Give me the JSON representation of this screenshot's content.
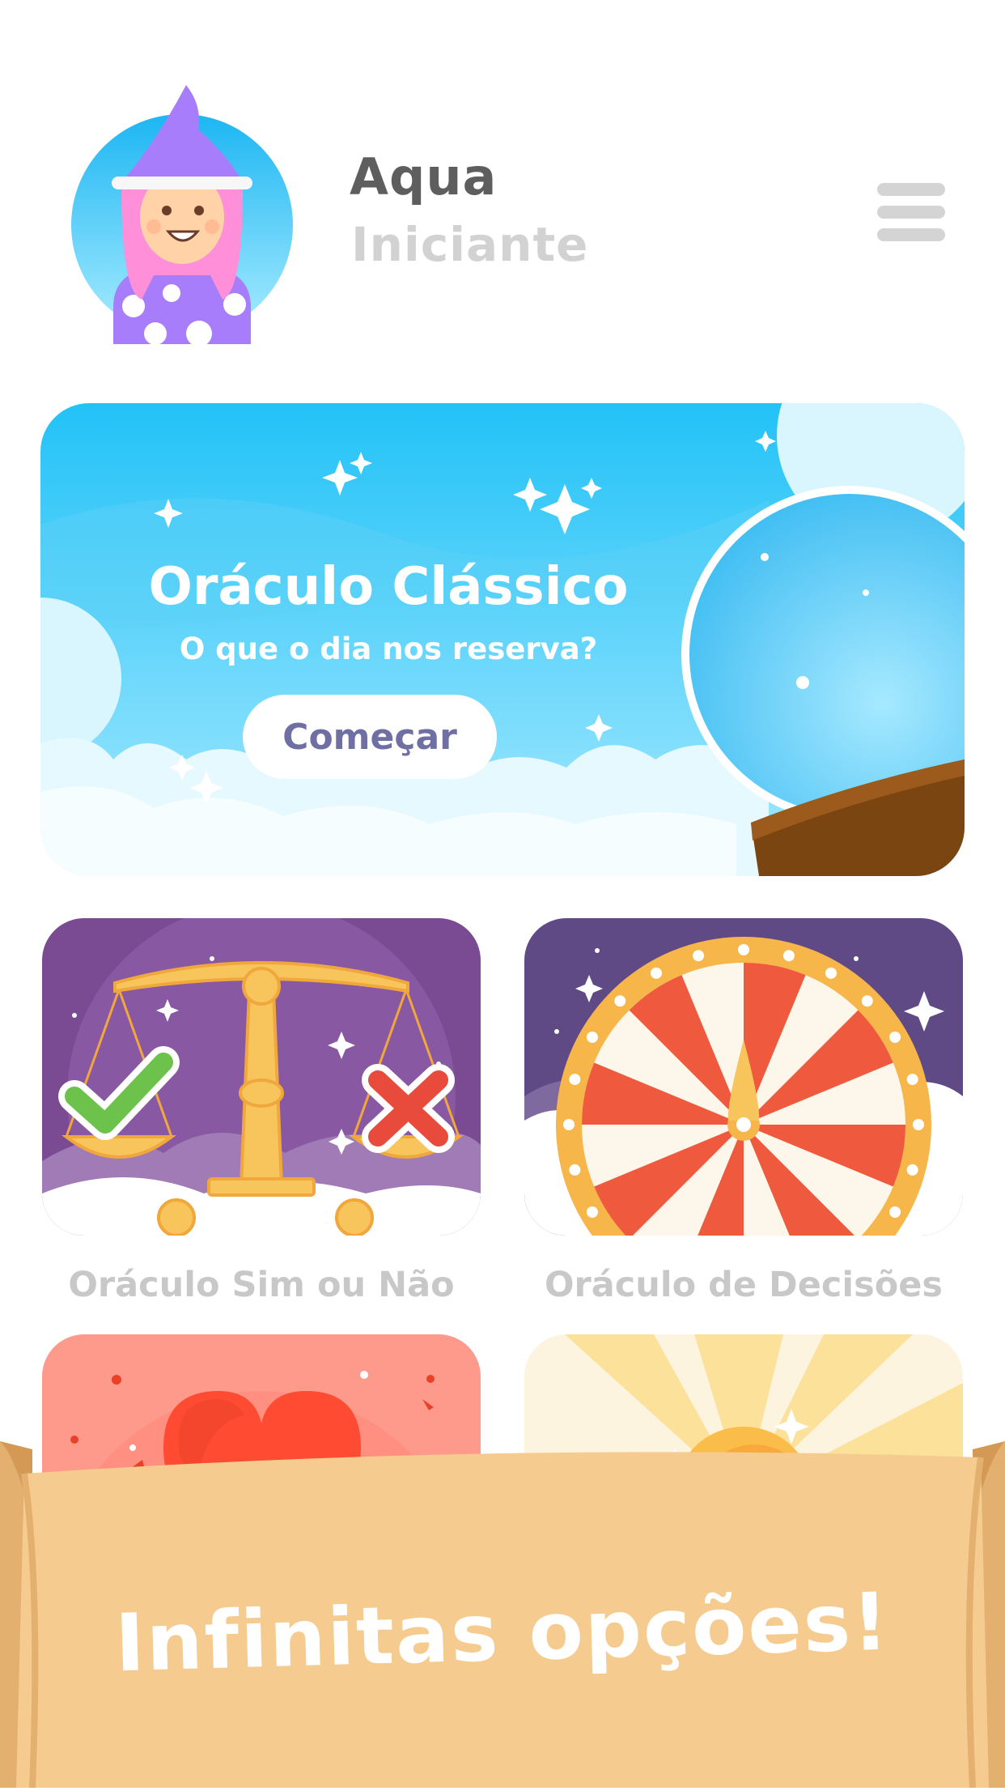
{
  "profile": {
    "name": "Aqua",
    "level": "Iniciante"
  },
  "menu": {
    "icon": "hamburger-menu-icon"
  },
  "hero": {
    "title": "Oráculo Clássico",
    "subtitle": "O que o dia nos reserva?",
    "button_label": "Começar",
    "colors": {
      "sky": "#3fc4f5",
      "cloud": "#d9f6ff",
      "button_text": "#6f6fa4"
    }
  },
  "oracles": [
    {
      "label": "Oráculo Sim ou Não",
      "icon": "scales-icon"
    },
    {
      "label": "Oráculo de Decisões",
      "icon": "wheel-icon"
    },
    {
      "label": "",
      "icon": "heart-icon"
    },
    {
      "label": "",
      "icon": "sun-icon"
    }
  ],
  "banner": {
    "text": "Infinitas opções!",
    "color": "#f5cb8f"
  }
}
